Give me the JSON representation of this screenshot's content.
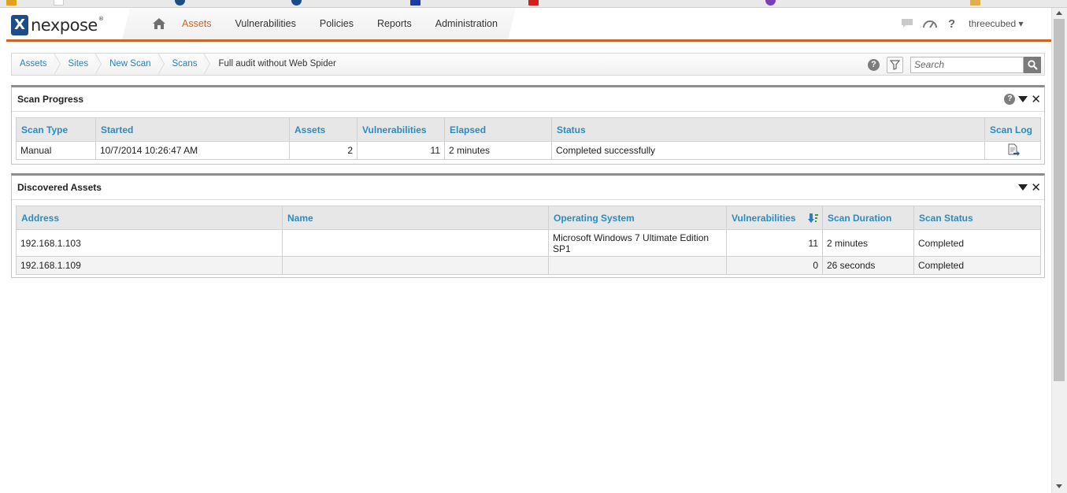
{
  "app": {
    "name": "nexpose"
  },
  "nav": {
    "items": [
      "Assets",
      "Vulnerabilities",
      "Policies",
      "Reports",
      "Administration"
    ],
    "active": "Assets"
  },
  "user": {
    "name": "threecubed ▾"
  },
  "breadcrumb": [
    "Assets",
    "Sites",
    "New Scan",
    "Scans",
    "Full audit without Web Spider"
  ],
  "search": {
    "placeholder": "Search"
  },
  "scan_progress": {
    "title": "Scan Progress",
    "columns": [
      "Scan Type",
      "Started",
      "Assets",
      "Vulnerabilities",
      "Elapsed",
      "Status",
      "Scan Log"
    ],
    "row": {
      "scan_type": "Manual",
      "started": "10/7/2014 10:26:47 AM",
      "assets": "2",
      "vulnerabilities": "11",
      "elapsed": "2 minutes",
      "status": "Completed successfully"
    }
  },
  "discovered_assets": {
    "title": "Discovered Assets",
    "columns": [
      "Address",
      "Name",
      "Operating System",
      "Vulnerabilities",
      "Scan Duration",
      "Scan Status"
    ],
    "rows": [
      {
        "address": "192.168.1.103",
        "name": "",
        "os": "Microsoft Windows 7 Ultimate Edition SP1",
        "vulnerabilities": "11",
        "duration": "2 minutes",
        "status": "Completed"
      },
      {
        "address": "192.168.1.109",
        "name": "",
        "os": "",
        "vulnerabilities": "0",
        "duration": "26 seconds",
        "status": "Completed"
      }
    ]
  },
  "colors": {
    "accent": "#c8662a",
    "link": "#2a7fb3",
    "header_text": "#2b8bbf"
  }
}
